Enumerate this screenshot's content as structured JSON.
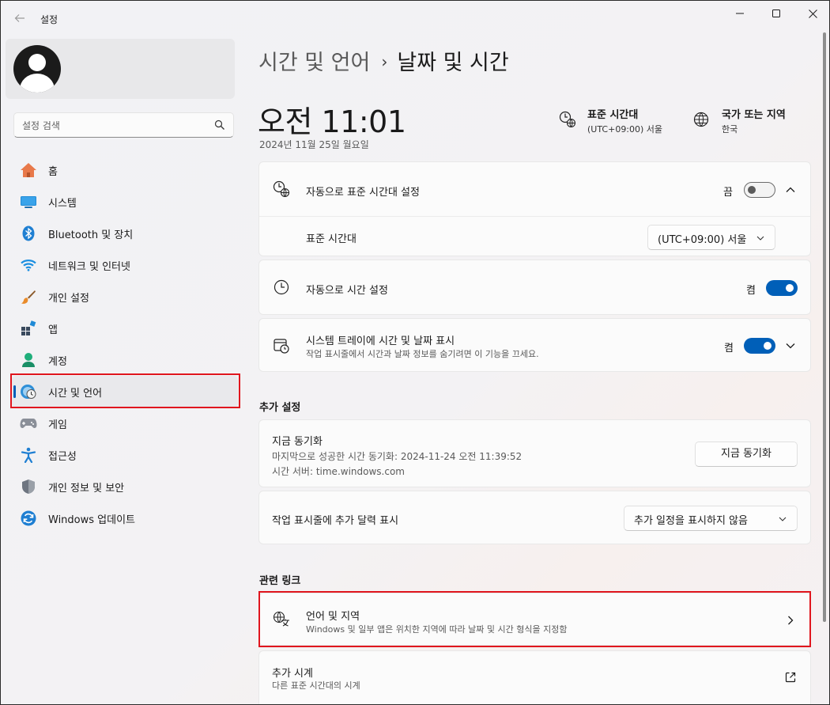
{
  "window": {
    "title": "설정"
  },
  "profile": {},
  "search": {
    "placeholder": "설정 검색"
  },
  "sidebar": {
    "items": [
      {
        "label": "홈",
        "icon": "home-icon"
      },
      {
        "label": "시스템",
        "icon": "system-icon"
      },
      {
        "label": "Bluetooth 및 장치",
        "icon": "bluetooth-icon"
      },
      {
        "label": "네트워크 및 인터넷",
        "icon": "wifi-icon"
      },
      {
        "label": "개인 설정",
        "icon": "brush-icon"
      },
      {
        "label": "앱",
        "icon": "apps-icon"
      },
      {
        "label": "계정",
        "icon": "account-icon"
      },
      {
        "label": "시간 및 언어",
        "icon": "time-language-icon",
        "selected": true
      },
      {
        "label": "게임",
        "icon": "gamepad-icon"
      },
      {
        "label": "접근성",
        "icon": "accessibility-icon"
      },
      {
        "label": "개인 정보 및 보안",
        "icon": "shield-icon"
      },
      {
        "label": "Windows 업데이트",
        "icon": "update-icon"
      }
    ]
  },
  "breadcrumb": {
    "parent": "시간 및 언어",
    "separator": "›",
    "current": "날짜 및 시간"
  },
  "clock": {
    "time": "오전 11:01",
    "date": "2024년 11월 25일 월요일"
  },
  "timezone_info": {
    "title": "표준 시간대",
    "value": "(UTC+09:00) 서울"
  },
  "region_info": {
    "title": "국가 또는 지역",
    "value": "한국"
  },
  "auto_timezone": {
    "title": "자동으로 표준 시간대 설정",
    "state_label": "끔",
    "on": false
  },
  "timezone_row": {
    "title": "표준 시간대",
    "selected": "(UTC+09:00) 서울"
  },
  "auto_time": {
    "title": "자동으로 시간 설정",
    "state_label": "켬",
    "on": true
  },
  "tray_time": {
    "title": "시스템 트레이에 시간 및 날짜 표시",
    "subtitle": "작업 표시줄에서 시간과 날짜 정보를 숨기려면 이 기능을 끄세요.",
    "state_label": "켬",
    "on": true
  },
  "additional": {
    "heading": "추가 설정"
  },
  "sync": {
    "title": "지금 동기화",
    "last_sync": "마지막으로 성공한 시간 동기화: 2024-11-24 오전 11:39:52",
    "server": "시간 서버: time.windows.com",
    "button": "지금 동기화"
  },
  "extra_calendar": {
    "title": "작업 표시줄에 추가 달력 표시",
    "selected": "추가 일정을 표시하지 않음"
  },
  "related": {
    "heading": "관련 링크"
  },
  "language_region": {
    "title": "언어 및 지역",
    "subtitle": "Windows 및 일부 앱은 위치한 지역에 따라 날짜 및 시간 형식을 지정함"
  },
  "additional_clocks": {
    "title": "추가 시계",
    "subtitle": "다른 표준 시간대의 시계"
  },
  "colors": {
    "accent": "#005fb8",
    "highlight": "#e0161e"
  }
}
